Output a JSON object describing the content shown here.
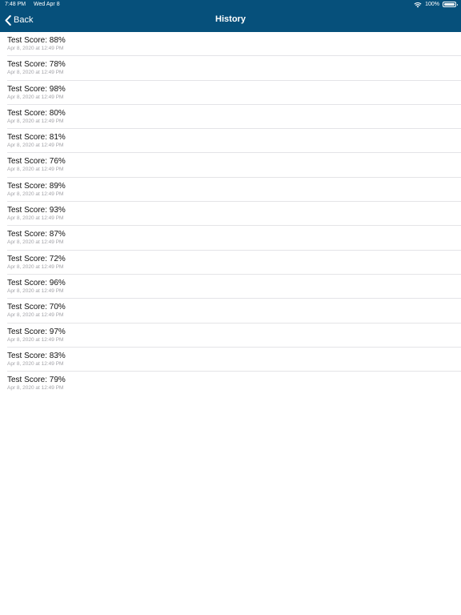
{
  "status_bar": {
    "time": "7:48 PM",
    "date": "Wed Apr 8",
    "battery_text": "100%"
  },
  "nav": {
    "back_label": "Back",
    "title": "History"
  },
  "colors": {
    "header_background": "#06507b",
    "header_text": "#ffffff",
    "row_subtitle": "#a3a3a8",
    "separator": "#e4e4e7"
  },
  "icons": {
    "back": "chevron-left-icon",
    "wifi": "wifi-icon",
    "battery": "battery-icon"
  },
  "history": [
    {
      "title": "Test Score: 88%",
      "date": "Apr 8, 2020 at 12:49 PM"
    },
    {
      "title": "Test Score: 78%",
      "date": "Apr 8, 2020 at 12:49 PM"
    },
    {
      "title": "Test Score: 98%",
      "date": "Apr 8, 2020 at 12:49 PM"
    },
    {
      "title": "Test Score: 80%",
      "date": "Apr 8, 2020 at 12:49 PM"
    },
    {
      "title": "Test Score: 81%",
      "date": "Apr 8, 2020 at 12:49 PM"
    },
    {
      "title": "Test Score: 76%",
      "date": "Apr 8, 2020 at 12:49 PM"
    },
    {
      "title": "Test Score: 89%",
      "date": "Apr 8, 2020 at 12:49 PM"
    },
    {
      "title": "Test Score: 93%",
      "date": "Apr 8, 2020 at 12:49 PM"
    },
    {
      "title": "Test Score: 87%",
      "date": "Apr 8, 2020 at 12:49 PM"
    },
    {
      "title": "Test Score: 72%",
      "date": "Apr 8, 2020 at 12:49 PM"
    },
    {
      "title": "Test Score: 96%",
      "date": "Apr 8, 2020 at 12:49 PM"
    },
    {
      "title": "Test Score: 70%",
      "date": "Apr 8, 2020 at 12:49 PM"
    },
    {
      "title": "Test Score: 97%",
      "date": "Apr 8, 2020 at 12:49 PM"
    },
    {
      "title": "Test Score: 83%",
      "date": "Apr 8, 2020 at 12:49 PM"
    },
    {
      "title": "Test Score: 79%",
      "date": "Apr 8, 2020 at 12:49 PM"
    }
  ]
}
